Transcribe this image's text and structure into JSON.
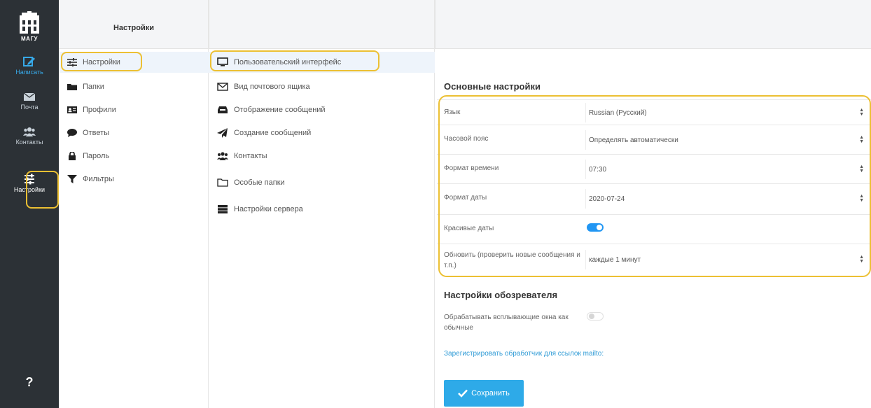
{
  "brand": {
    "logo_text": "МАГУ"
  },
  "nav": {
    "compose": "Написать",
    "mail": "Почта",
    "contacts": "Контакты",
    "settings": "Настройки",
    "help": "?"
  },
  "column1": {
    "title": "Настройки",
    "items": [
      {
        "label": "Настройки",
        "icon": "sliders-icon"
      },
      {
        "label": "Папки",
        "icon": "folder-icon"
      },
      {
        "label": "Профили",
        "icon": "id-card-icon"
      },
      {
        "label": "Ответы",
        "icon": "comment-icon"
      },
      {
        "label": "Пароль",
        "icon": "lock-icon"
      },
      {
        "label": "Фильтры",
        "icon": "filter-icon"
      }
    ]
  },
  "column2": {
    "items": [
      {
        "label": "Пользовательский интерфейс",
        "icon": "monitor-icon"
      },
      {
        "label": "Вид почтового ящика",
        "icon": "envelope-icon"
      },
      {
        "label": "Отображение сообщений",
        "icon": "inbox-icon"
      },
      {
        "label": "Создание сообщений",
        "icon": "paper-plane-icon"
      },
      {
        "label": "Контакты",
        "icon": "users-icon"
      },
      {
        "label": "Особые папки",
        "icon": "folder-outline-icon"
      },
      {
        "label": "Настройки сервера",
        "icon": "server-icon"
      }
    ]
  },
  "main": {
    "section1_title": "Основные настройки",
    "language_label": "Язык",
    "language_value": "Russian (Русский)",
    "timezone_label": "Часовой пояс",
    "timezone_value": "Определять автоматически",
    "time_format_label": "Формат времени",
    "time_format_value": "07:30",
    "date_format_label": "Формат даты",
    "date_format_value": "2020-07-24",
    "pretty_dates_label": "Красивые даты",
    "pretty_dates_on": true,
    "refresh_label": "Обновить (проверить новые сообщения и т.п.)",
    "refresh_value": "каждые 1 минут",
    "section2_title": "Настройки обозревателя",
    "popups_label": "Обрабатывать всплывающие окна как обычные",
    "popups_on": false,
    "mailto_link": "Зарегистрировать обработчик для ссылок mailto:",
    "save_label": "Сохранить"
  },
  "colors": {
    "nav_bg": "#2c3136",
    "accent": "#2eaae8",
    "highlight": "#ecc033",
    "toggle_on": "#2196f3"
  }
}
